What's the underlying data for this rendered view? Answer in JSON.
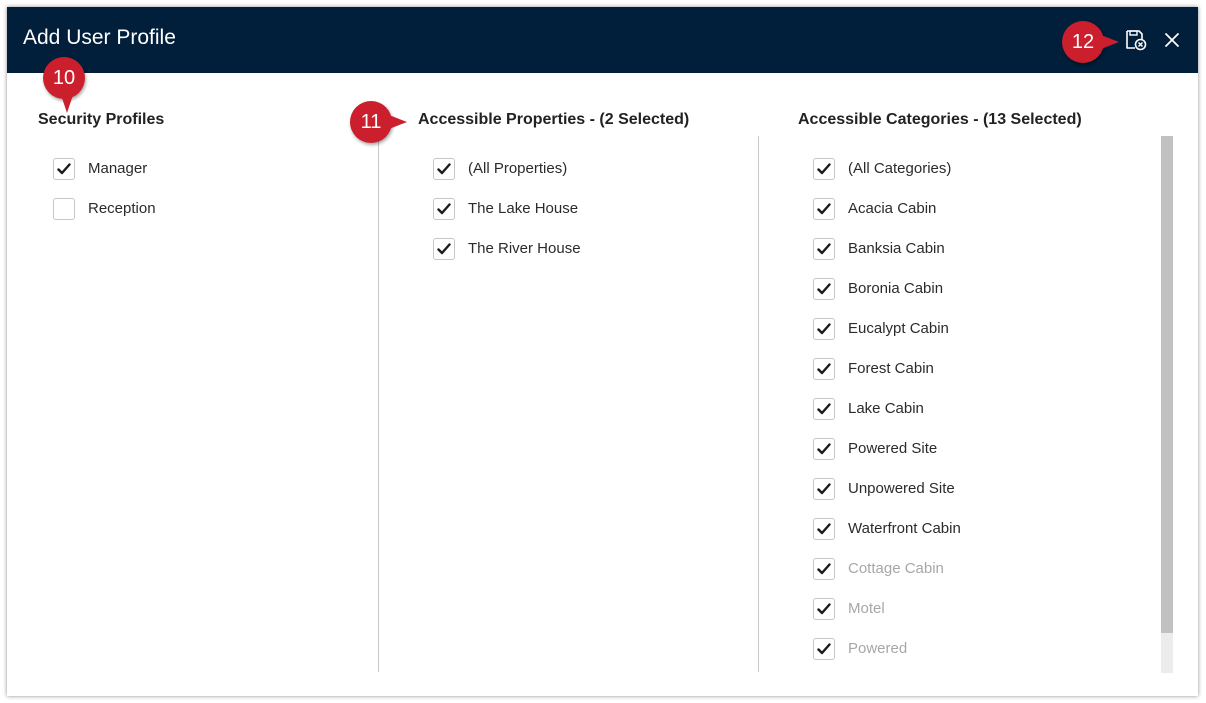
{
  "dialog": {
    "title": "Add User Profile",
    "save_icon": "save-and-close-icon",
    "close_icon": "close-icon"
  },
  "colors": {
    "header_bg": "#011e3a",
    "callout": "#cc1f2e",
    "muted_text": "#a7a7a7"
  },
  "security_profiles": {
    "title": "Security Profiles",
    "items": [
      {
        "label": "Manager",
        "checked": true,
        "muted": false
      },
      {
        "label": "Reception",
        "checked": false,
        "muted": false
      }
    ]
  },
  "accessible_properties": {
    "title": "Accessible Properties - (2 Selected)",
    "items": [
      {
        "label": "(All Properties)",
        "checked": true,
        "muted": false
      },
      {
        "label": "The Lake House",
        "checked": true,
        "muted": false
      },
      {
        "label": "The River House",
        "checked": true,
        "muted": false
      }
    ]
  },
  "accessible_categories": {
    "title": "Accessible Categories - (13 Selected)",
    "items": [
      {
        "label": "(All Categories)",
        "checked": true,
        "muted": false
      },
      {
        "label": "Acacia Cabin",
        "checked": true,
        "muted": false
      },
      {
        "label": "Banksia Cabin",
        "checked": true,
        "muted": false
      },
      {
        "label": "Boronia Cabin",
        "checked": true,
        "muted": false
      },
      {
        "label": "Eucalypt Cabin",
        "checked": true,
        "muted": false
      },
      {
        "label": "Forest Cabin",
        "checked": true,
        "muted": false
      },
      {
        "label": "Lake Cabin",
        "checked": true,
        "muted": false
      },
      {
        "label": "Powered Site",
        "checked": true,
        "muted": false
      },
      {
        "label": "Unpowered Site",
        "checked": true,
        "muted": false
      },
      {
        "label": "Waterfront Cabin",
        "checked": true,
        "muted": false
      },
      {
        "label": "Cottage Cabin",
        "checked": true,
        "muted": true
      },
      {
        "label": "Motel",
        "checked": true,
        "muted": true
      },
      {
        "label": "Powered",
        "checked": true,
        "muted": true
      }
    ]
  },
  "callouts": [
    {
      "number": "10"
    },
    {
      "number": "11"
    },
    {
      "number": "12"
    }
  ]
}
